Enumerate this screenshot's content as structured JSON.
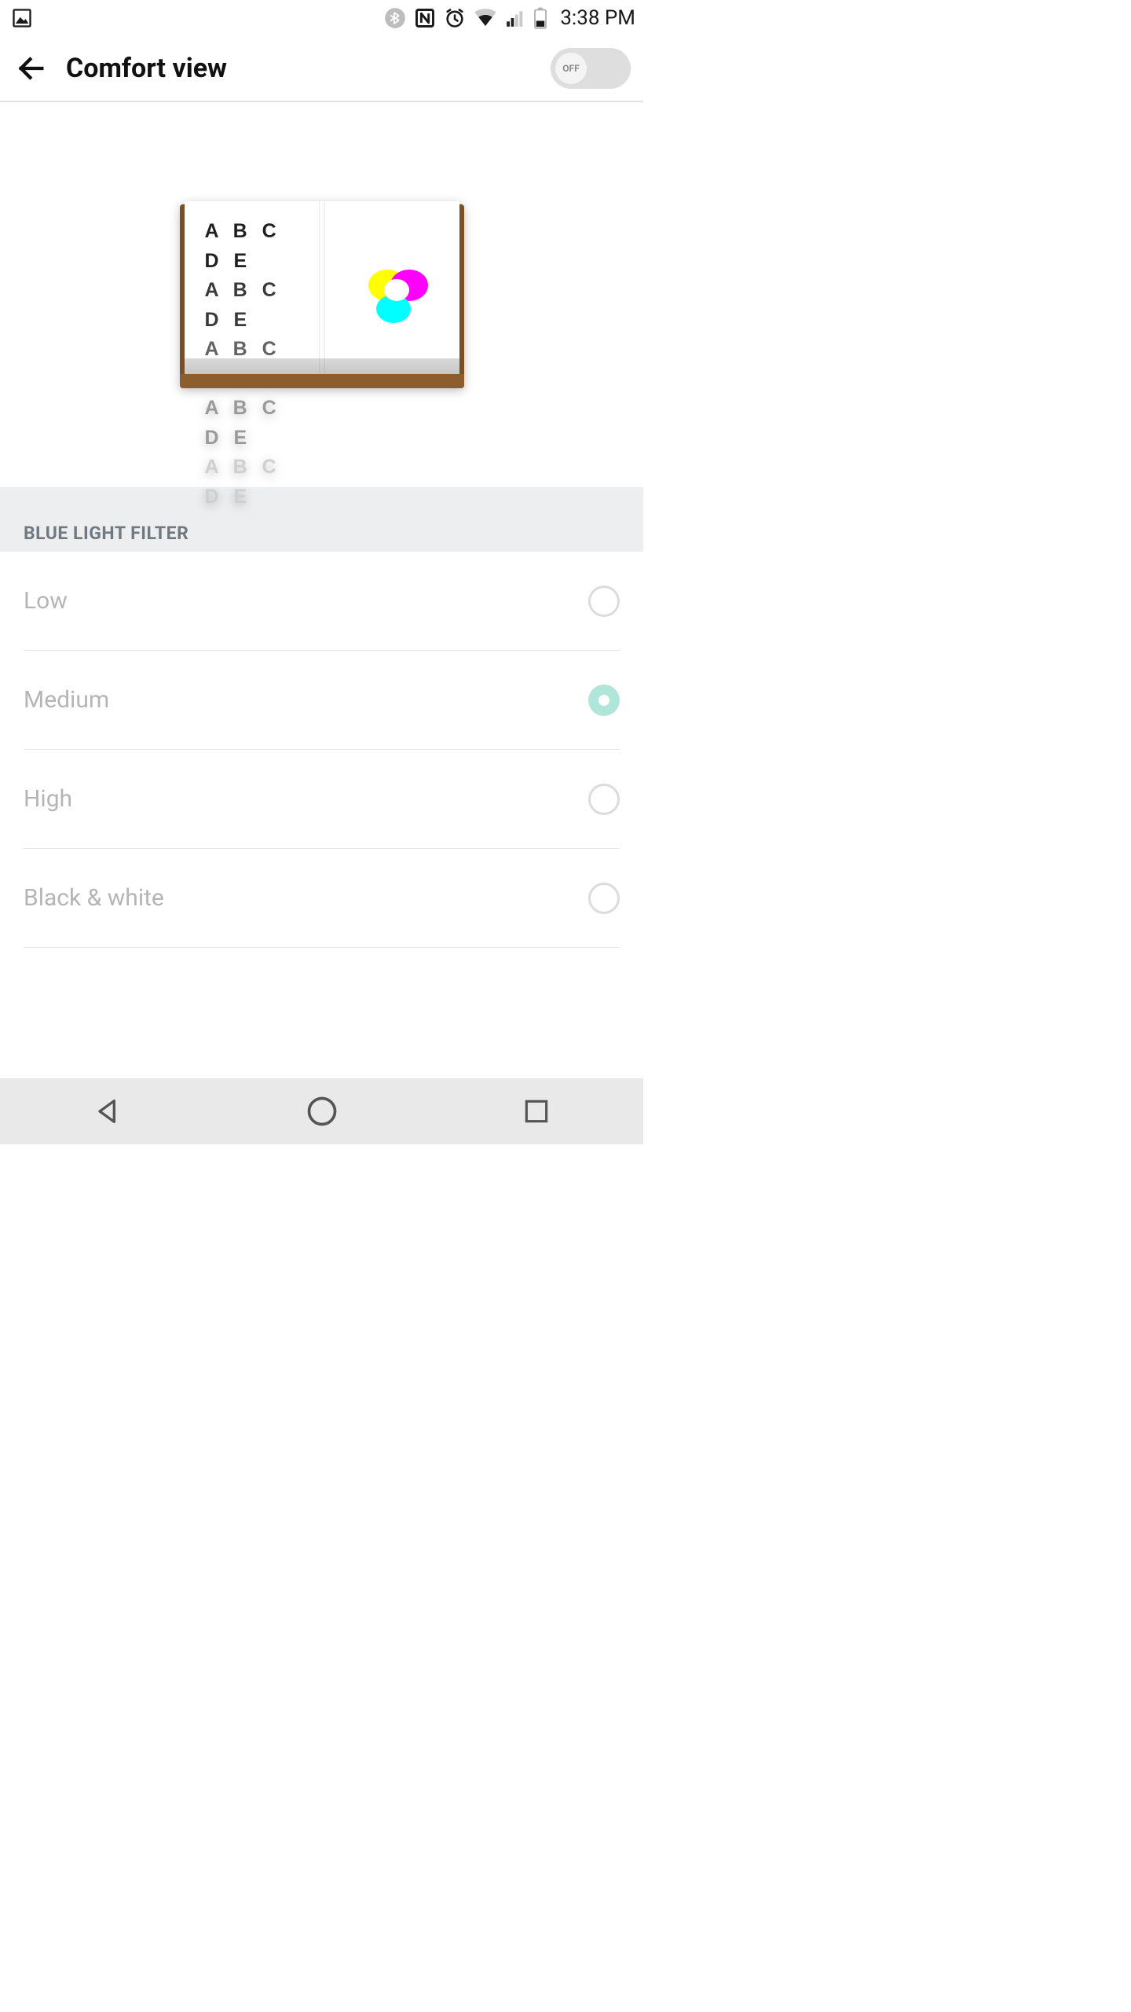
{
  "status": {
    "time": "3:38 PM"
  },
  "header": {
    "title": "Comfort view",
    "toggle_label": "OFF"
  },
  "preview": {
    "text_lines": [
      "A B C D E",
      "A B C D E",
      "A B C D E",
      "A B C D E",
      "A B C D E"
    ]
  },
  "section": {
    "title": "BLUE LIGHT FILTER"
  },
  "options": [
    {
      "label": "Low",
      "selected": false
    },
    {
      "label": "Medium",
      "selected": true
    },
    {
      "label": "High",
      "selected": false
    },
    {
      "label": "Black & white",
      "selected": false
    }
  ]
}
